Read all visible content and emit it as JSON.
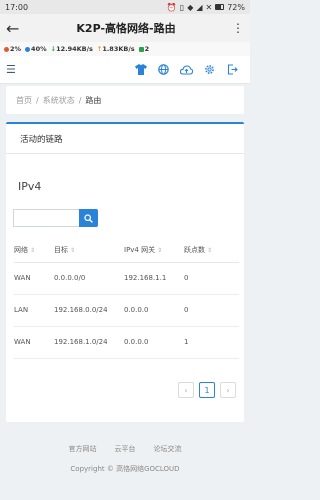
{
  "status_bar": {
    "time": "17:00",
    "battery": "72%"
  },
  "app_title": "K2P-高恪网络-路由",
  "info_bar": {
    "cpu": "2%",
    "mem": "40%",
    "down": "12.94KB/s",
    "up": "1.83KB/s",
    "users": "2",
    "colors": {
      "cpu": "#e05a2a",
      "mem": "#2a83d6",
      "down": "#2aa34a",
      "up": "#e9a21a",
      "users": "#2aa34a"
    }
  },
  "toolbar": {
    "icons": [
      "shirt-icon",
      "globe-icon",
      "cloud-upload-icon",
      "settings-icon",
      "logout-icon"
    ]
  },
  "breadcrumb": {
    "home": "首页",
    "sep1": "/",
    "status": "系统状态",
    "sep2": "/",
    "current": "路由"
  },
  "panel": {
    "title": "活动的链路",
    "subtitle": "IPv4",
    "search_placeholder": "",
    "columns": [
      "网络",
      "目标",
      "IPv4 网关",
      "跃点数"
    ],
    "rows": [
      [
        "WAN",
        "0.0.0.0/0",
        "192.168.1.1",
        "0"
      ],
      [
        "LAN",
        "192.168.0.0/24",
        "0.0.0.0",
        "0"
      ],
      [
        "WAN",
        "192.168.1.0/24",
        "0.0.0.0",
        "1"
      ]
    ],
    "pagination": {
      "prev": "‹",
      "page": "1",
      "next": "›"
    }
  },
  "footer": {
    "link1": "官方网站",
    "link2": "云平台",
    "link3": "论坛交流",
    "copyright": "Copyright © 高恪网络GOCLOUD"
  },
  "accent": "#2a83d6"
}
